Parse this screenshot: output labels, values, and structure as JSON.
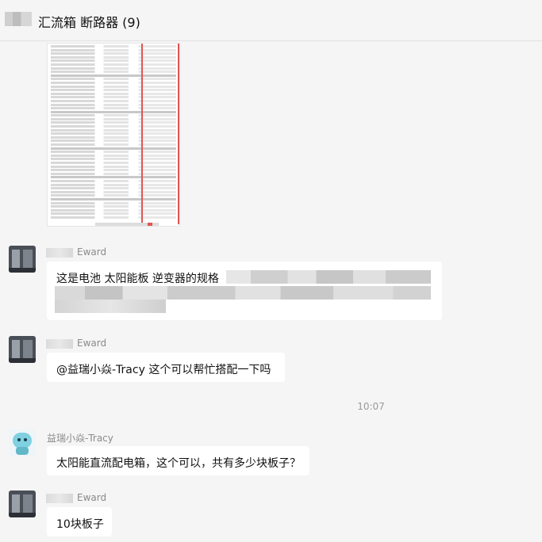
{
  "header": {
    "title": "汇流箱 断路器 (9)"
  },
  "messages": [
    {
      "sender": "Eward",
      "text": "这是电池  太阳能板 逆变器的规格"
    },
    {
      "sender": "Eward",
      "text": "@益瑞小焱-Tracy   这个可以帮忙搭配一下吗"
    },
    {
      "sender": "益瑞小焱-Tracy",
      "text": "太阳能直流配电箱，这个可以，共有多少块板子？"
    },
    {
      "sender": "Eward",
      "text": "10块板子"
    }
  ],
  "timestamp": "10:07"
}
